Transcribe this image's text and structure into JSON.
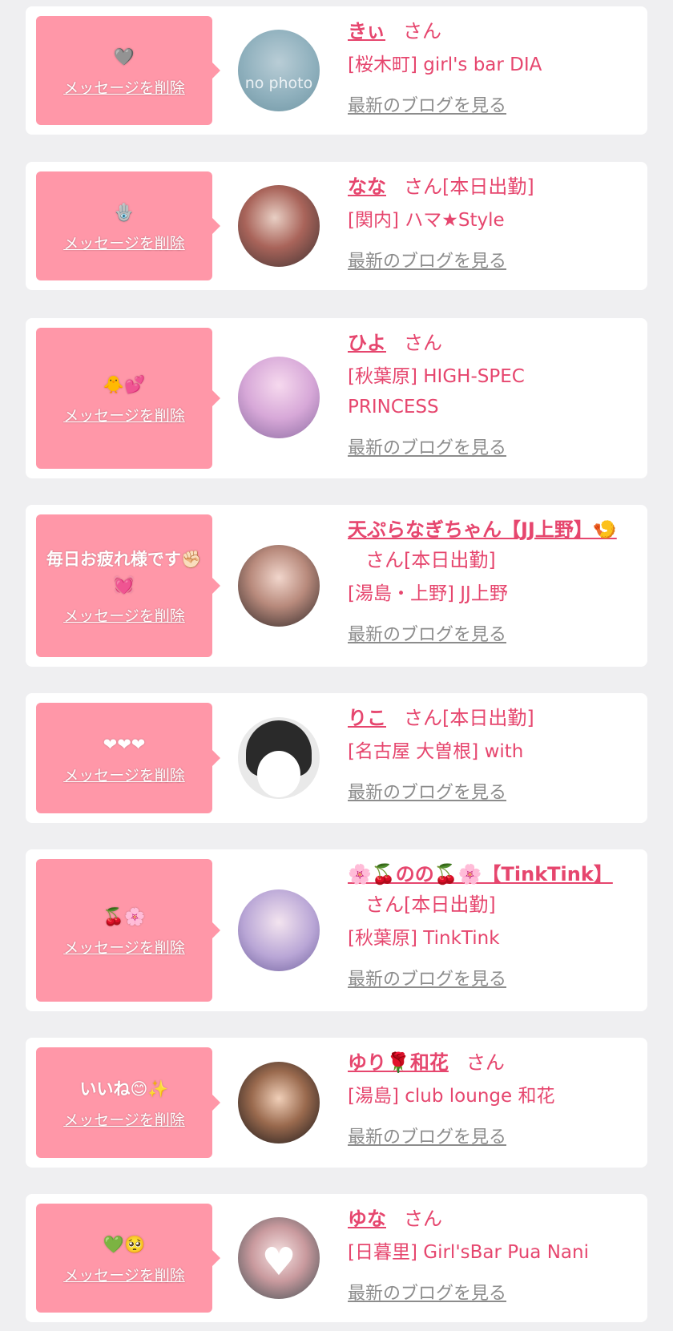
{
  "delete_label": "メッセージを削除",
  "blog_label": "最新のブログを見る",
  "honorific": "さん",
  "cards": [
    {
      "message": "🩶",
      "name": "きぃ",
      "status": "",
      "shop": "[桜木町] girl's bar DIA",
      "avatar_text": "no photo"
    },
    {
      "message": "🪬",
      "name": "なな",
      "status": "[本日出勤]",
      "shop": "[関内] ハマ★Style",
      "avatar_text": ""
    },
    {
      "message": "🐥💕",
      "name": "ひよ",
      "status": "",
      "shop": "[秋葉原] HIGH-SPEC PRINCESS",
      "avatar_text": ""
    },
    {
      "message": "毎日お疲れ様です✊🏻💓",
      "name": "天ぷらなぎちゃん【JJ上野】🍤",
      "status": "[本日出勤]",
      "shop": "[湯島・上野] JJ上野",
      "avatar_text": ""
    },
    {
      "message": "❤❤❤",
      "name": "りこ",
      "status": "[本日出勤]",
      "shop": "[名古屋 大曽根] with",
      "avatar_text": ""
    },
    {
      "message": "🍒🌸",
      "name": "🌸🍒のの🍒🌸【TinkTink】",
      "status": "[本日出勤]",
      "shop": "[秋葉原] TinkTink",
      "avatar_text": ""
    },
    {
      "message": "いいね😊✨",
      "name": "ゆり🌹和花",
      "status": "",
      "shop": "[湯島] club lounge 和花",
      "avatar_text": ""
    },
    {
      "message": "💚🥺",
      "name": "ゆな",
      "status": "",
      "shop": "[日暮里] Girl'sBar Pua Nani",
      "avatar_text": ""
    }
  ]
}
